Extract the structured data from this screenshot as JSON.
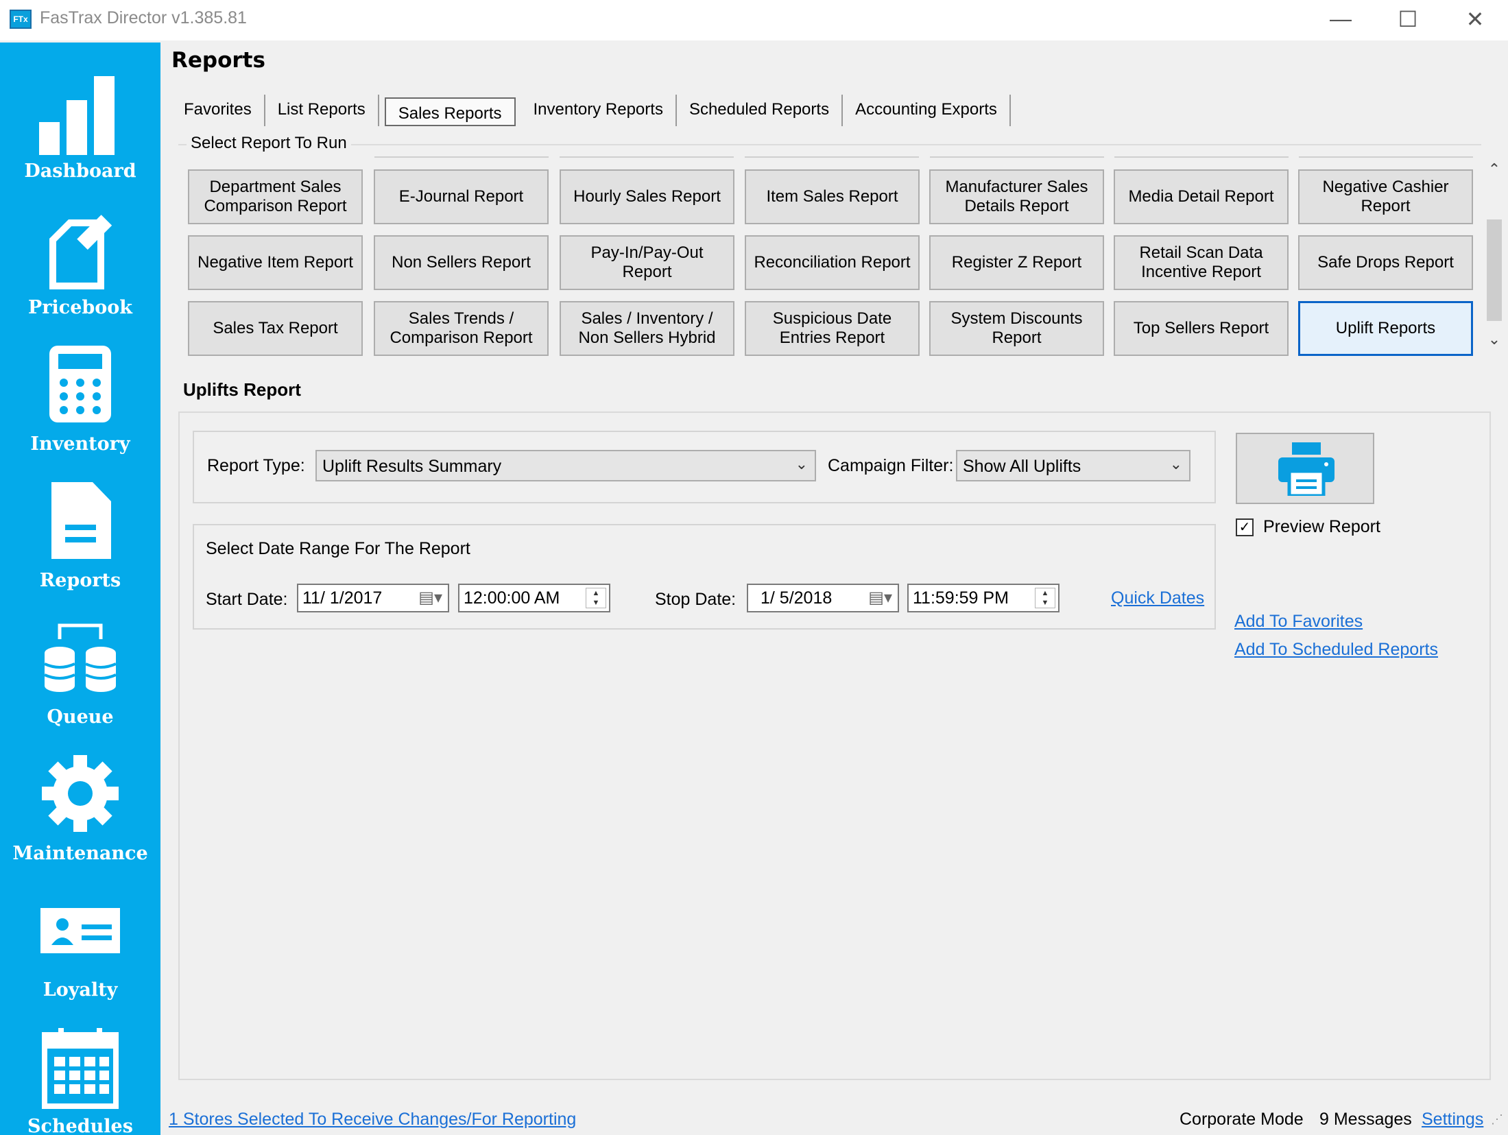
{
  "window": {
    "title": "FasTrax Director v1.385.81",
    "icon_text": "FTx",
    "minimize": "—",
    "maximize": "☐",
    "close": "✕"
  },
  "sidebar": {
    "items": [
      {
        "label": "Dashboard",
        "icon": "bar-chart-icon"
      },
      {
        "label": "Pricebook",
        "icon": "pricebook-icon"
      },
      {
        "label": "Inventory",
        "icon": "calculator-icon"
      },
      {
        "label": "Reports",
        "icon": "document-icon"
      },
      {
        "label": "Queue",
        "icon": "database-transfer-icon"
      },
      {
        "label": "Maintenance",
        "icon": "gear-icon"
      },
      {
        "label": "Loyalty",
        "icon": "member-card-icon"
      },
      {
        "label": "Schedules",
        "icon": "calendar-icon"
      }
    ]
  },
  "page": {
    "title": "Reports"
  },
  "tabs": [
    {
      "label": "Favorites"
    },
    {
      "label": "List Reports"
    },
    {
      "label": "Sales Reports",
      "selected": true
    },
    {
      "label": "Inventory Reports"
    },
    {
      "label": "Scheduled Reports"
    },
    {
      "label": "Accounting Exports"
    }
  ],
  "report_group": {
    "label": "Select Report To Run",
    "buttons": [
      [
        "Department Sales Comparison Report",
        "E-Journal Report",
        "Hourly Sales Report",
        "Item Sales Report",
        "Manufacturer Sales Details Report",
        "Media Detail Report",
        "Negative Cashier Report"
      ],
      [
        "Negative Item Report",
        "Non Sellers Report",
        "Pay-In/Pay-Out Report",
        "Reconciliation Report",
        "Register Z Report",
        "Retail Scan Data Incentive Report",
        "Safe Drops Report"
      ],
      [
        "Sales Tax Report",
        "Sales Trends / Comparison Report",
        "Sales / Inventory / Non Sellers Hybrid",
        "Suspicious Date Entries Report",
        "System Discounts Report",
        "Top Sellers Report",
        "Uplift Reports"
      ]
    ],
    "active": "Uplift Reports"
  },
  "uplifts": {
    "title": "Uplifts Report",
    "report_type_label": "Report Type:",
    "report_type_value": "Uplift Results Summary",
    "campaign_filter_label": "Campaign Filter:",
    "campaign_filter_value": "Show All Uplifts",
    "date_range_label": "Select Date Range For The Report",
    "start_date_label": "Start Date:",
    "start_date": "11/  1/2017",
    "start_time": "12:00:00 AM",
    "stop_date_label": "Stop Date:",
    "stop_date": "1/  5/2018",
    "stop_time": "11:59:59 PM",
    "quick_dates": "Quick Dates",
    "preview_label": "Preview Report",
    "preview_checked": true,
    "add_favorites": "Add To Favorites",
    "add_scheduled": "Add To Scheduled Reports"
  },
  "statusbar": {
    "stores_link": "1 Stores Selected To Receive Changes/For Reporting",
    "mode": "Corporate Mode",
    "messages": "9 Messages",
    "settings": "Settings"
  },
  "colors": {
    "sidebar": "#04aaea",
    "accent": "#0a64c8",
    "link": "#1a6fd6",
    "printer_icon": "#0a9ee0"
  }
}
